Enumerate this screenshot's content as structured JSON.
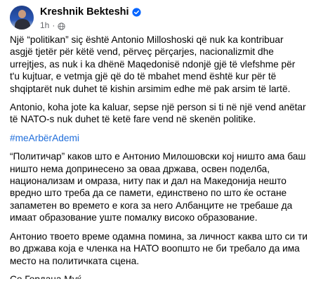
{
  "author": {
    "name": "Kreshnik Bekteshi",
    "time": "1h",
    "verified_icon": "verified-badge-icon",
    "audience_icon": "globe-icon"
  },
  "colors": {
    "hashtag": "#216fdb",
    "verified": "#0866ff",
    "secondary_text": "#65676b"
  },
  "post": {
    "para1": "Një “politikan” siç është Antonio Milloshoski që nuk ka kontribuar asgjë tjetër për këtë vend, përveç përçarjes, nacionalizmit dhe urrejtjes, as nuk i ka dhënë Maqedonisë ndonjë gjë të vlefshme për t'u kujtuar, e vetmja gjë që do të mbahet mend është kur për të shqiptarët nuk duhet të kishin arsimim edhe më pak arsim të lartë.",
    "para2": "Antonio, koha jote ka kaluar, sepse një person si ti në një vend anëtar të NATO-s nuk duhet të ketë fare vend në skenën politike.",
    "hashtag": "#meArbërAdemi",
    "para3": "“Политичар” каков што е Антонио Милошовски кој ништо ама баш ништо нема допринесено за оваа држава, освен поделба, национализам и омраза, ниту пак  и дал на Македонија нешто вредно што треба да се памети, единствено по што ќе остане запаметен во времето е кога за него Албанците не требаше да имаат образование уште помалку високо образование.",
    "para4": "Антонио твоето време одамна помина, за личност каква што си ти во држава која е членка на НАТО воопшто не би требало да има место на политичката сцена.",
    "para5": "Со Гордана Муќ"
  }
}
